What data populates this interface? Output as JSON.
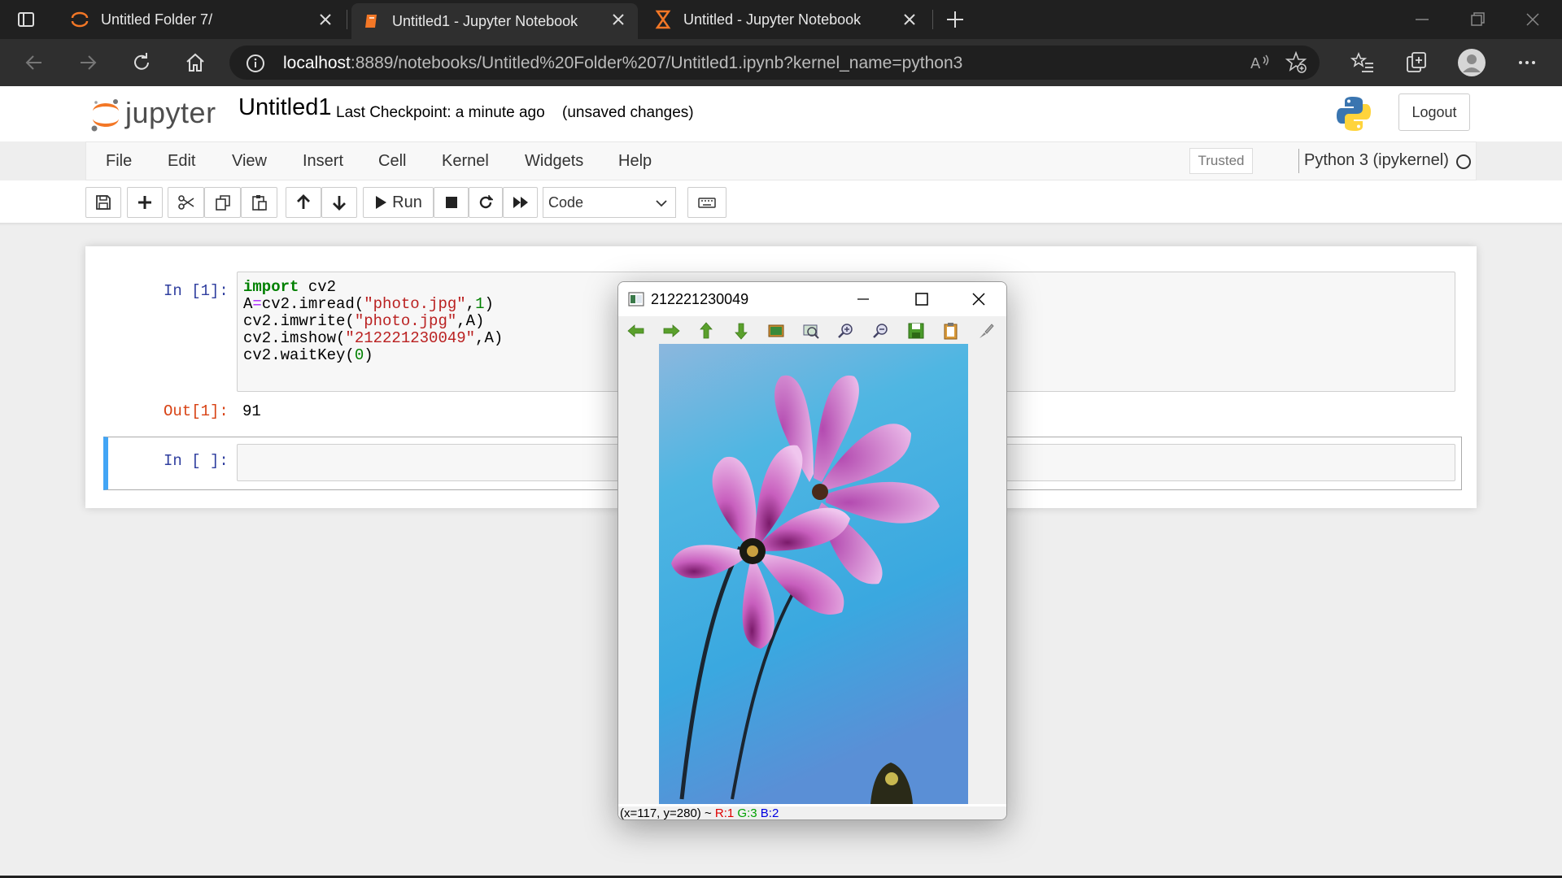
{
  "browser": {
    "tabs": [
      {
        "title": "Untitled Folder 7/"
      },
      {
        "title": "Untitled1 - Jupyter Notebook"
      },
      {
        "title": "Untitled - Jupyter Notebook"
      }
    ],
    "url_host": "localhost",
    "url_rest": ":8889/notebooks/Untitled%20Folder%207/Untitled1.ipynb?kernel_name=python3"
  },
  "header": {
    "logo_text": "jupyter",
    "notebook_name": "Untitled1",
    "checkpoint": "Last Checkpoint: a minute ago",
    "status": "(unsaved changes)",
    "logout_label": "Logout"
  },
  "menubar": {
    "items": [
      "File",
      "Edit",
      "View",
      "Insert",
      "Cell",
      "Kernel",
      "Widgets",
      "Help"
    ],
    "trusted": "Trusted",
    "kernel_name": "Python 3 (ipykernel)"
  },
  "toolbar": {
    "run_label": "Run",
    "cell_type": "Code"
  },
  "cells": [
    {
      "in_prompt": "In [1]:",
      "code": [
        {
          "p": [
            {
              "k": "kw",
              "t": "import"
            },
            {
              "k": "",
              "t": " cv2"
            }
          ]
        },
        {
          "p": [
            {
              "k": "",
              "t": "A"
            },
            {
              "k": "op",
              "t": "="
            },
            {
              "k": "",
              "t": "cv2.imread("
            },
            {
              "k": "str",
              "t": "\"photo.jpg\""
            },
            {
              "k": "",
              "t": ","
            },
            {
              "k": "num",
              "t": "1"
            },
            {
              "k": "",
              "t": ")"
            }
          ]
        },
        {
          "p": [
            {
              "k": "",
              "t": "cv2.imwrite("
            },
            {
              "k": "str",
              "t": "\"photo.jpg\""
            },
            {
              "k": "",
              "t": ",A)"
            }
          ]
        },
        {
          "p": [
            {
              "k": "",
              "t": "cv2.imshow("
            },
            {
              "k": "str",
              "t": "\"212221230049\""
            },
            {
              "k": "",
              "t": ",A)"
            }
          ]
        },
        {
          "p": [
            {
              "k": "",
              "t": "cv2.waitKey("
            },
            {
              "k": "num",
              "t": "0"
            },
            {
              "k": "",
              "t": ")"
            }
          ]
        }
      ],
      "out_prompt": "Out[1]:",
      "output": "91"
    },
    {
      "in_prompt": "In [ ]:"
    }
  ],
  "cv_window": {
    "title": "212221230049",
    "status_coords": "(x=117, y=280) ~",
    "status_r": "R:1",
    "status_g": "G:3",
    "status_b": "B:2"
  },
  "colors": {
    "accent_orange": "#f37726",
    "cell_selected": "#42a5f5",
    "in_prompt": "#303f9f",
    "out_prompt": "#d84315"
  }
}
